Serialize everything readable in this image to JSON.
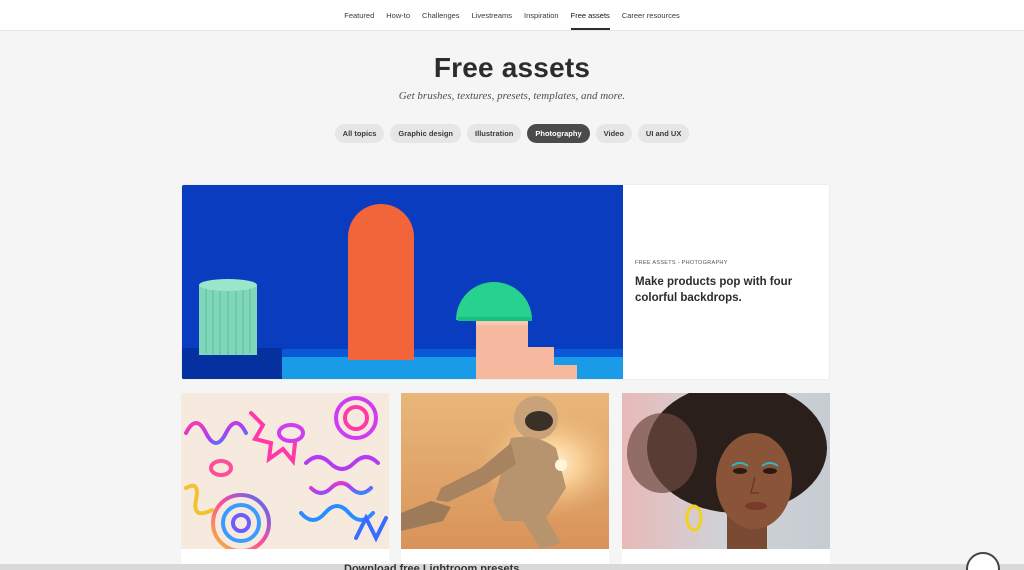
{
  "nav": {
    "items": [
      {
        "label": "Featured"
      },
      {
        "label": "How-to"
      },
      {
        "label": "Challenges"
      },
      {
        "label": "Livestreams"
      },
      {
        "label": "Inspiration"
      },
      {
        "label": "Free assets"
      },
      {
        "label": "Career resources"
      }
    ],
    "active": "Free assets"
  },
  "header": {
    "title": "Free assets",
    "subtitle": "Get brushes, textures, presets, templates, and more."
  },
  "filters": {
    "items": [
      {
        "label": "All topics"
      },
      {
        "label": "Graphic design"
      },
      {
        "label": "Illustration"
      },
      {
        "label": "Photography"
      },
      {
        "label": "Video"
      },
      {
        "label": "UI and UX"
      }
    ],
    "selected": "Photography"
  },
  "featured": {
    "meta": "FREE ASSETS - PHOTOGRAPHY",
    "headline": "Make products pop with four colorful backdrops."
  },
  "bottom_peek": {
    "text": "Download free Lightroom presets"
  },
  "colors": {
    "accent_dark": "#4b4b4b",
    "backdrop_blue": "#0a3cc0",
    "arch_orange": "#f2643a",
    "mint": "#7fd6b8"
  }
}
